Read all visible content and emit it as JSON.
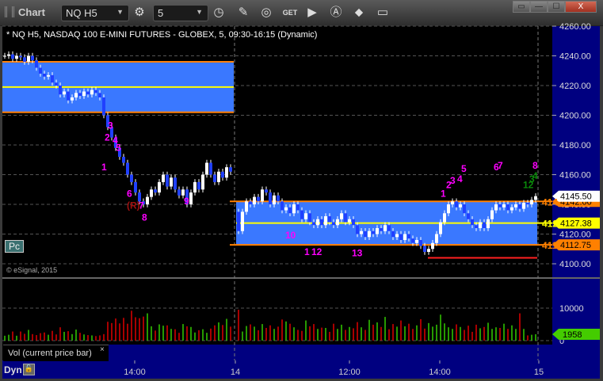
{
  "window": {
    "title": "Chart",
    "symbol": "NQ H5",
    "interval": "5"
  },
  "toolbar": {
    "icons": [
      "gear-icon",
      "clock-icon",
      "pencil-icon",
      "study-icon",
      "get-icon",
      "play-icon",
      "alert-icon",
      "link-icon",
      "comment-icon"
    ]
  },
  "window_buttons": {
    "restore": "▭",
    "minimize": "—",
    "maximize": "☐",
    "close": "X"
  },
  "chart_header": "* NQ H5, NASDAQ 100 E-MINI FUTURES - GLOBEX, 5, 09:30-16:15 (Dynamic)",
  "pc_button": "Pc",
  "copyright": "© eSignal, 2015",
  "volume_pane": {
    "label": "Vol (current price bar)",
    "close": "×",
    "axis_labels": [
      "10000",
      "0"
    ],
    "current_tag": "1958"
  },
  "bottom": {
    "dyn": "Dyn",
    "lock": "🔓"
  },
  "colors": {
    "box": "#3a78ff",
    "orange": "#ff8000",
    "yellow": "#ffff00",
    "magenta": "#ff00ff",
    "green_count": "#0a8a0a",
    "up_vol": "#33cc00",
    "down_vol": "#e00000",
    "axis_bg": "#000080"
  },
  "chart_data": {
    "type": "candlestick",
    "ylim": [
      4100,
      4260
    ],
    "price_ticks": [
      "4260.00",
      "4240.00",
      "4220.00",
      "4200.00",
      "4180.00",
      "4160.00",
      "4140.00",
      "4120.00",
      "4100.00"
    ],
    "time_labels": [
      "14:00",
      "14",
      "12:00",
      "14:00",
      "15"
    ],
    "closes": [
      4240,
      4241,
      4238,
      4240,
      4239,
      4236,
      4240,
      4237,
      4232,
      4228,
      4226,
      4227,
      4222,
      4220,
      4214,
      4216,
      4210,
      4212,
      4215,
      4213,
      4216,
      4214,
      4217,
      4215,
      4212,
      4200,
      4192,
      4185,
      4178,
      4172,
      4168,
      4160,
      4155,
      4148,
      4142,
      4140,
      4145,
      4150,
      4148,
      4155,
      4160,
      4152,
      4158,
      4150,
      4146,
      4150,
      4140,
      4148,
      4155,
      4150,
      4160,
      4168,
      4160,
      4155,
      4162,
      4158,
      4165,
      4162,
      4122,
      4135,
      4142,
      4140,
      4145,
      4142,
      4150,
      4148,
      4140,
      4146,
      4142,
      4136,
      4138,
      4134,
      4140,
      4136,
      4130,
      4134,
      4128,
      4126,
      4130,
      4126,
      4132,
      4128,
      4126,
      4130,
      4134,
      4128,
      4130,
      4126,
      4120,
      4122,
      4118,
      4122,
      4120,
      4124,
      4122,
      4126,
      4122,
      4118,
      4120,
      4116,
      4120,
      4117,
      4114,
      4116,
      4112,
      4108,
      4110,
      4114,
      4120,
      4128,
      4134,
      4140,
      4142,
      4138,
      4140,
      4134,
      4130,
      4126,
      4124,
      4128,
      4124,
      4130,
      4136,
      4140,
      4138,
      4140,
      4136,
      4138,
      4140,
      4137,
      4141,
      4140,
      4143,
      4145.5
    ],
    "volumes": [
      1500,
      1800,
      2800,
      1500,
      2800,
      2100,
      3300,
      2000,
      1700,
      2300,
      2500,
      1800,
      3000,
      1900,
      4100,
      2700,
      2900,
      2000,
      3400,
      2400,
      1900,
      1700,
      1600,
      1400,
      1600,
      2000,
      5800,
      5400,
      6800,
      5300,
      7000,
      5200,
      9200,
      7200,
      6900,
      7400,
      8400,
      4400,
      3100,
      5000,
      4600,
      4700,
      3600,
      3500,
      2400,
      5100,
      4400,
      4200,
      2500,
      3200,
      3500,
      2400,
      3700,
      4700,
      5600,
      4800,
      6700,
      4300,
      9500,
      2800,
      4500,
      5000,
      4300,
      3200,
      5100,
      3900,
      4700,
      3600,
      4300,
      6500,
      5900,
      5200,
      4100,
      3300,
      3000,
      6200,
      4400,
      5100,
      3600,
      4000,
      3900,
      2700,
      5200,
      3600,
      4900,
      3300,
      4200,
      3800,
      5700,
      4100,
      3300,
      6400,
      4900,
      5600,
      4200,
      7300,
      3500,
      5100,
      4300,
      6200,
      4400,
      5200,
      3600,
      4700,
      6600,
      3700,
      5400,
      4300,
      4900,
      8000,
      5300,
      4100,
      3600,
      5000,
      4200,
      3300,
      4600,
      2700,
      4900,
      3800,
      4200,
      5500,
      3600,
      4100,
      3900,
      5200,
      3600,
      4700,
      3600,
      8400,
      3600,
      1600,
      1800,
      1958
    ],
    "levels": {
      "day2_high": "4142.00",
      "day2_mid": "4127.38",
      "day2_low": "4112.75",
      "last": "4145.50"
    },
    "side_labels": [
      "414",
      "412",
      "411"
    ],
    "annotations": [
      "1",
      "2",
      "3",
      "4",
      "5",
      "6",
      "7",
      "8",
      "9",
      "(R)",
      "10",
      "1",
      "12",
      "13",
      "1",
      "2",
      "3",
      "4",
      "5",
      "6",
      "7",
      "8",
      "12",
      "3",
      "4"
    ]
  }
}
